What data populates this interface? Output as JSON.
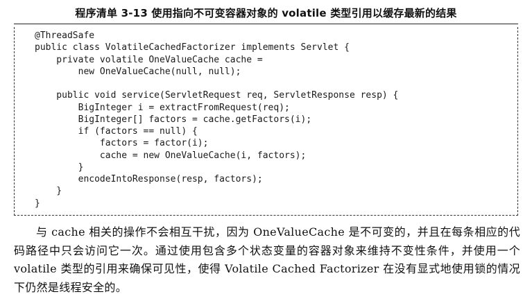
{
  "listing": {
    "title": "程序清单 3-13   使用指向不可变容器对象的 volatile 类型引用以缓存最新的结果",
    "code_lines": [
      "@ThreadSafe",
      "public class VolatileCachedFactorizer implements Servlet {",
      "    private volatile OneValueCache cache =",
      "        new OneValueCache(null, null);",
      "",
      "    public void service(ServletRequest req, ServletResponse resp) {",
      "        BigInteger i = extractFromRequest(req);",
      "        BigInteger[] factors = cache.getFactors(i);",
      "        if (factors == null) {",
      "            factors = factor(i);",
      "            cache = new OneValueCache(i, factors);",
      "        }",
      "        encodeIntoResponse(resp, factors);",
      "    }",
      "}"
    ]
  },
  "paragraph": "与 cache 相关的操作不会相互干扰，因为 OneValueCache 是不可变的，并且在每条相应的代码路径中只会访问它一次。通过使用包含多个状态变量的容器对象来维持不变性条件，并使用一个 volatile 类型的引用来确保可见性，使得 Volatile Cached Factorizer 在没有显式地使用锁的情况下仍然是线程安全的。"
}
